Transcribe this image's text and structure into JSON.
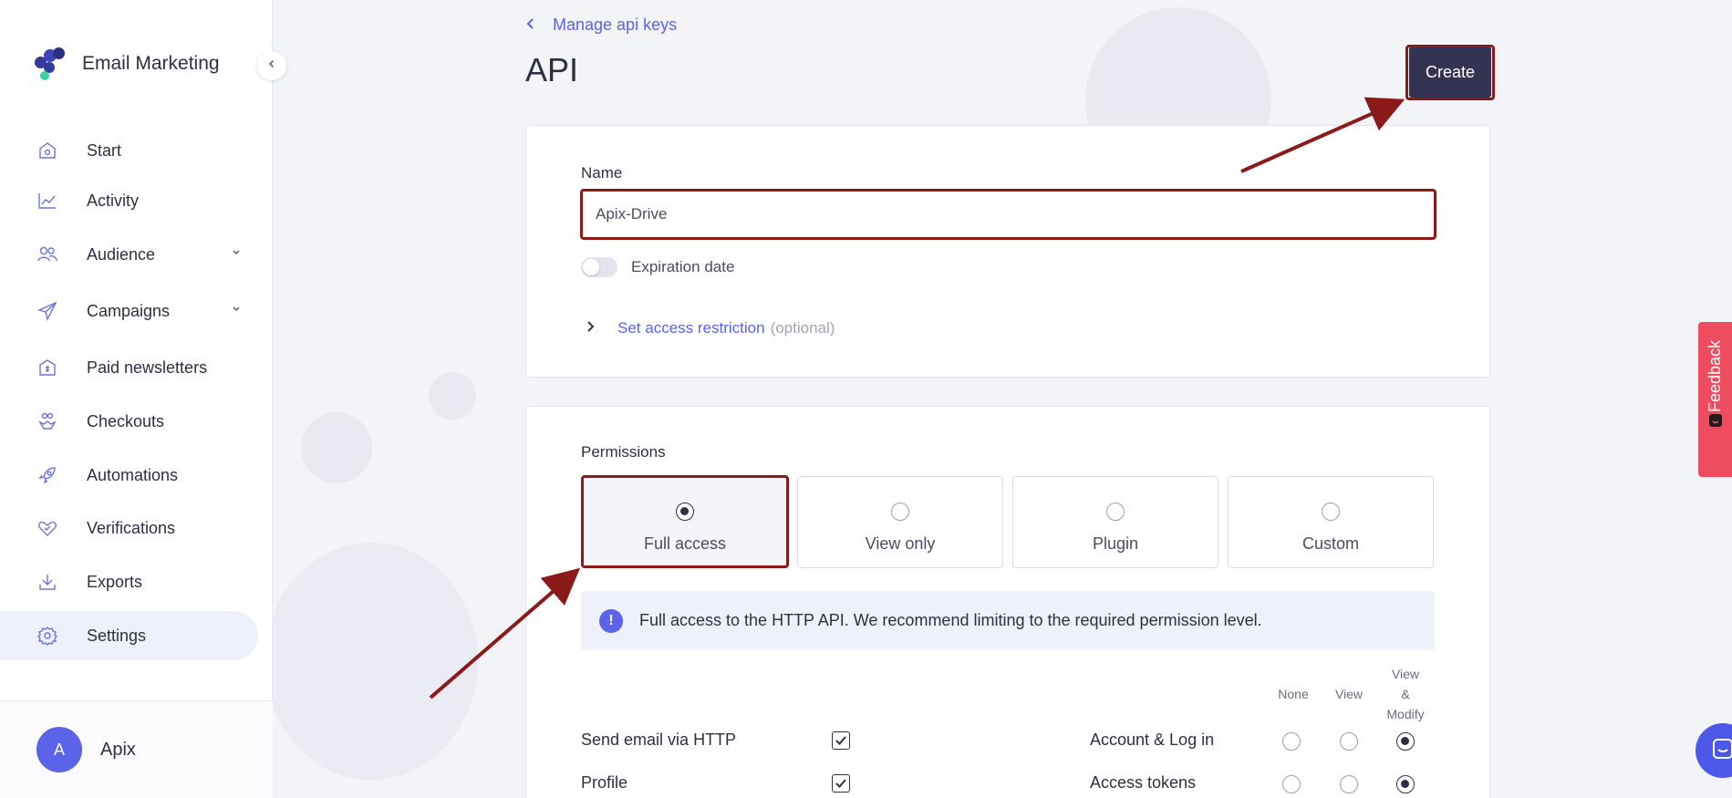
{
  "app": {
    "name": "Email Marketing"
  },
  "sidebar": {
    "items": [
      {
        "label": "Start",
        "icon": "home-icon"
      },
      {
        "label": "Activity",
        "icon": "chart-line-icon"
      },
      {
        "label": "Audience",
        "icon": "users-icon",
        "expandable": true
      },
      {
        "label": "Campaigns",
        "icon": "paper-plane-icon",
        "expandable": true
      },
      {
        "label": "Paid newsletters",
        "icon": "money-box-icon"
      },
      {
        "label": "Checkouts",
        "icon": "hand-coins-icon"
      },
      {
        "label": "Automations",
        "icon": "rocket-icon"
      },
      {
        "label": "Verifications",
        "icon": "heart-check-icon"
      },
      {
        "label": "Exports",
        "icon": "download-icon"
      },
      {
        "label": "Settings",
        "icon": "gear-icon",
        "active": true
      }
    ],
    "user": {
      "initial": "A",
      "name": "Apix"
    }
  },
  "header": {
    "back_label": "Manage api keys",
    "title": "API",
    "create_label": "Create"
  },
  "form": {
    "name_label": "Name",
    "name_value": "Apix-Drive",
    "expiration_label": "Expiration date",
    "expiration_enabled": false,
    "restriction_link": "Set access restriction",
    "restriction_optional": "(optional)"
  },
  "permissions": {
    "label": "Permissions",
    "options": [
      {
        "label": "Full access",
        "selected": true
      },
      {
        "label": "View only",
        "selected": false
      },
      {
        "label": "Plugin",
        "selected": false
      },
      {
        "label": "Custom",
        "selected": false
      }
    ],
    "info_text": "Full access to the HTTP API. We recommend limiting to the required permission level.",
    "columns": [
      "None",
      "View",
      "View & Modify"
    ],
    "left_rows": [
      {
        "label": "Send email via HTTP",
        "checked": true
      },
      {
        "label": "Profile",
        "checked": true
      }
    ],
    "right_rows": [
      {
        "label": "Account & Log in",
        "selected": "View & Modify"
      },
      {
        "label": "Access tokens",
        "selected": "View & Modify"
      }
    ]
  },
  "widgets": {
    "feedback_label": "Feedback"
  },
  "colors": {
    "accent": "#5b63e8",
    "primary_button": "#343452",
    "highlight": "#8b1a1a",
    "feedback": "#ef4d5f"
  }
}
